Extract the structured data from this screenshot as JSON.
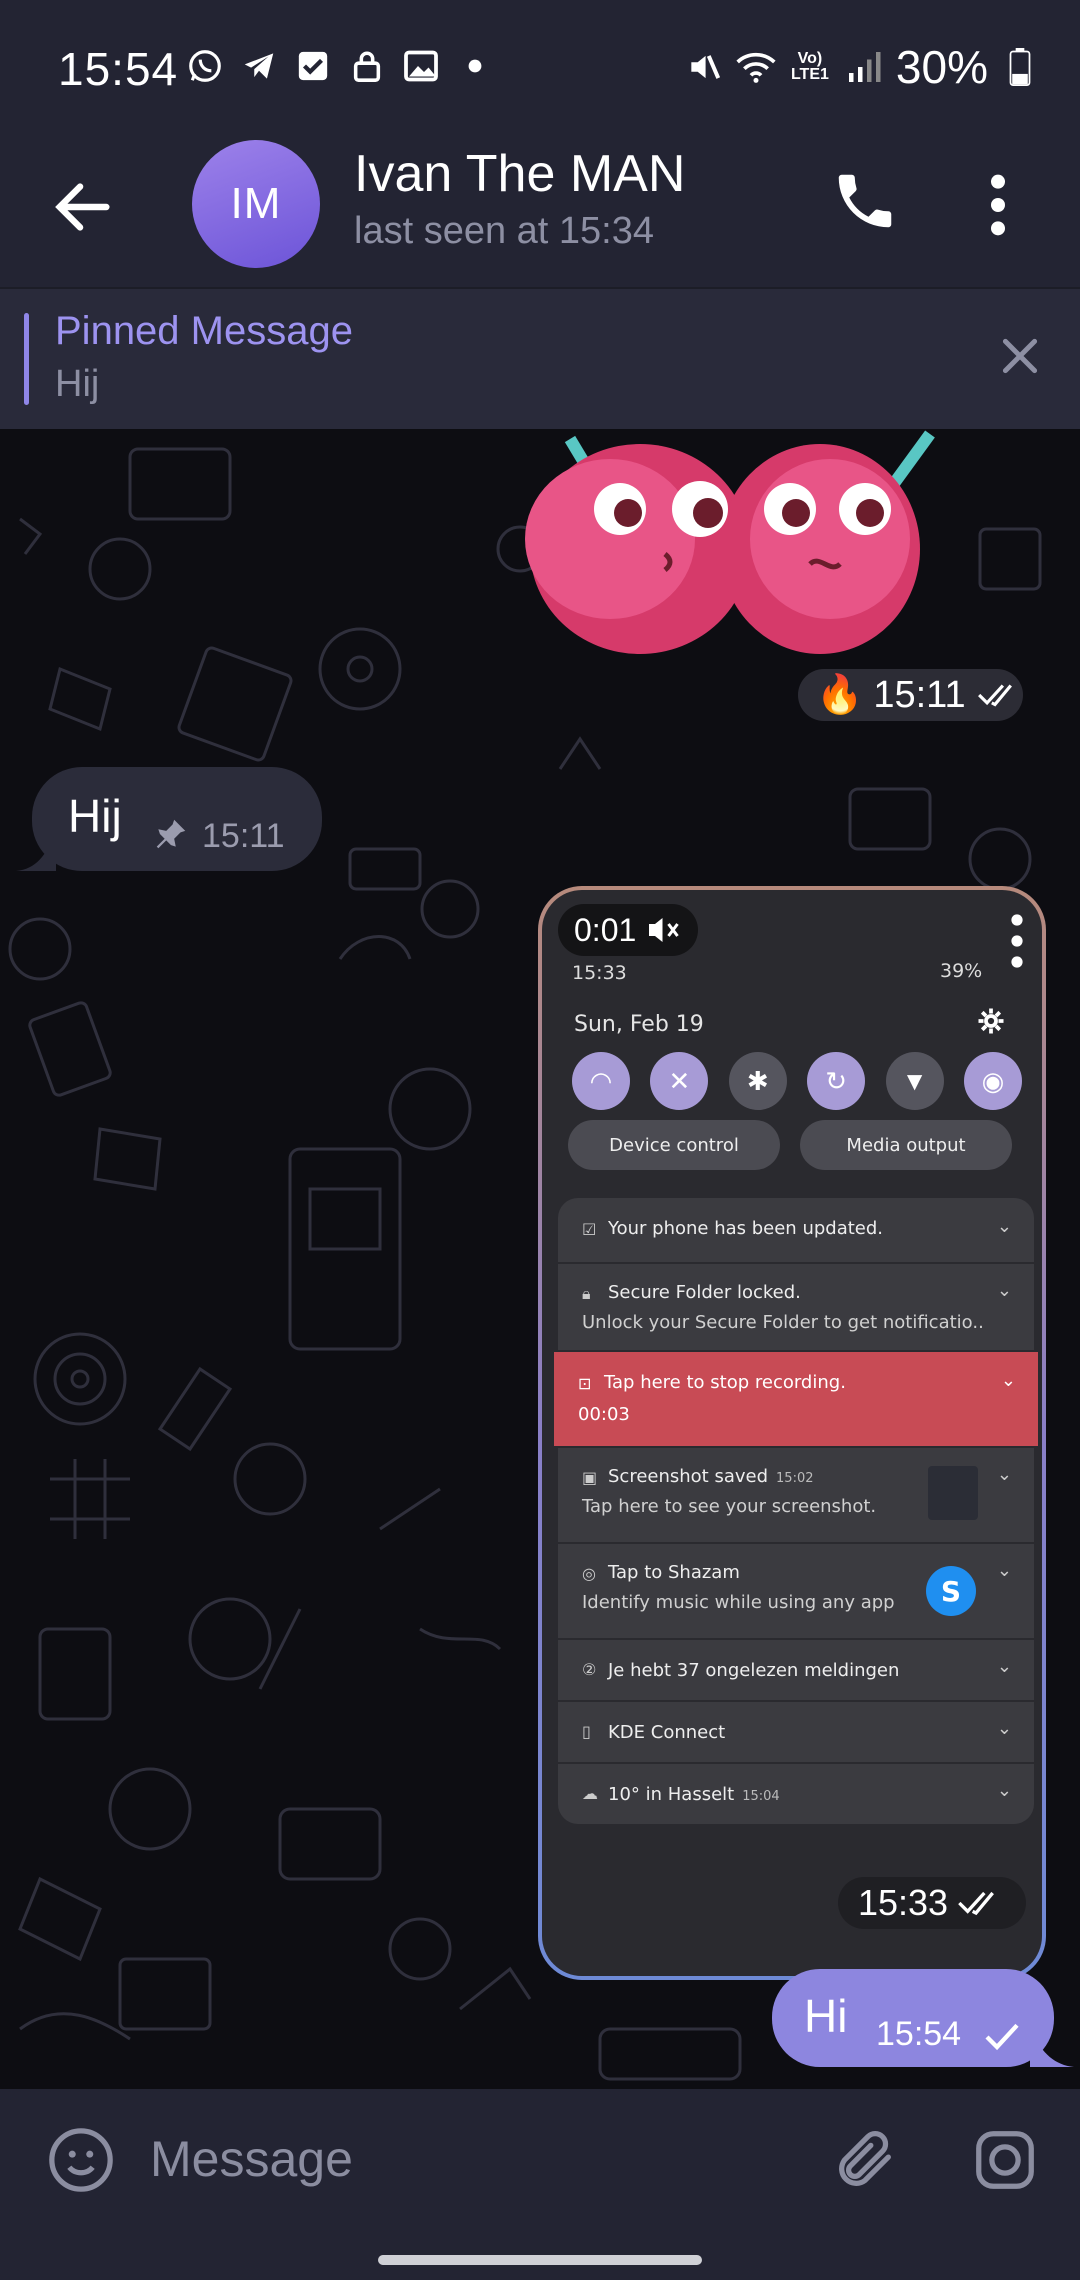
{
  "status_bar": {
    "time": "15:54",
    "battery": "30%",
    "icons": [
      "whatsapp-icon",
      "telegram-icon",
      "check-icon",
      "lock-icon",
      "image-icon",
      "dot-icon",
      "mute-icon",
      "wifi-icon",
      "volte-icon",
      "signal-icon",
      "battery-icon"
    ]
  },
  "header": {
    "avatar_initials": "IM",
    "name": "Ivan The MAN",
    "status": "last seen at 15:34"
  },
  "pinned": {
    "title": "Pinned Message",
    "text": "Hij"
  },
  "messages": {
    "sticker": {
      "reaction": "🔥",
      "time": "15:11"
    },
    "incoming": {
      "text": "Hij",
      "time": "15:11"
    },
    "image": {
      "time": "15:33",
      "screenshot": {
        "recording_time": "0:01",
        "clock": "15:33",
        "battery": "39%",
        "date": "Sun, Feb 19",
        "buttons": [
          "Device control",
          "Media output"
        ],
        "notifications": [
          {
            "title": "Your phone has been updated.",
            "subtitle": ""
          },
          {
            "title": "Secure Folder locked.",
            "subtitle": "Unlock your Secure Folder to get notificatio.."
          },
          {
            "title": "Tap here to stop recording.",
            "subtitle": "00:03"
          },
          {
            "title": "Screenshot saved",
            "time": "15:02",
            "subtitle": "Tap here to see your screenshot."
          },
          {
            "title": "Tap to Shazam",
            "subtitle": "Identify music while using any app"
          },
          {
            "title": "Je hebt 37 ongelezen meldingen",
            "subtitle": ""
          },
          {
            "title": "KDE Connect",
            "subtitle": ""
          },
          {
            "title": "10° in Hasselt",
            "time": "15:04",
            "subtitle": ""
          }
        ]
      }
    },
    "outgoing": {
      "text": "Hi",
      "time": "15:54"
    }
  },
  "input": {
    "placeholder": "Message"
  },
  "colors": {
    "header_bg": "#232433",
    "accent": "#8d86df",
    "avatar": "#7d66e0",
    "recording_red": "#c84b55"
  }
}
